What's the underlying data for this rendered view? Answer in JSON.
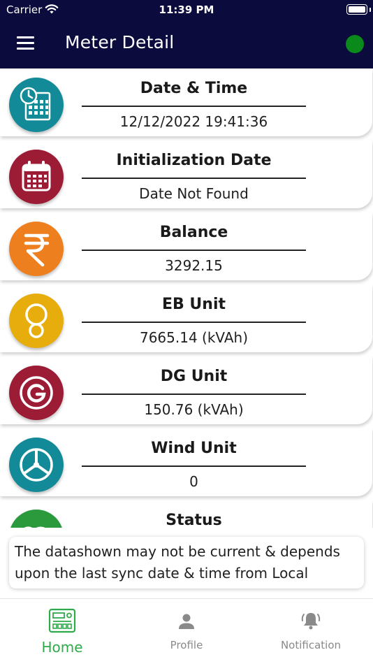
{
  "status_bar": {
    "carrier": "Carrier",
    "time": "11:39 PM"
  },
  "header": {
    "title": "Meter Detail",
    "connection_color": "#0a8a1a"
  },
  "items": [
    {
      "title": "Date & Time",
      "value": "12/12/2022 19:41:36",
      "icon": "calendar-clock-icon",
      "color": "#138a97"
    },
    {
      "title": "Initialization Date",
      "value": "Date Not Found",
      "icon": "calendar-icon",
      "color": "#9c1c35"
    },
    {
      "title": "Balance",
      "value": "3292.15",
      "icon": "rupee-icon",
      "color": "#ee7f1f"
    },
    {
      "title": "EB Unit",
      "value": "7665.14 (kVAh)",
      "icon": "bulb-icon",
      "color": "#e7ad0c"
    },
    {
      "title": "DG Unit",
      "value": "150.76 (kVAh)",
      "icon": "generator-icon",
      "color": "#9c1c35"
    },
    {
      "title": "Wind Unit",
      "value": "0",
      "icon": "wind-turbine-icon",
      "color": "#138a97"
    },
    {
      "title": "Status",
      "value": "",
      "icon": "status-icon",
      "color": "#2b9a3d"
    }
  ],
  "notice": {
    "text": "The datashown may not be current & depends upon the last sync date & time from Local"
  },
  "nav": {
    "home": {
      "label": "Home",
      "icon": "meter-icon",
      "color": "#2faa4a"
    },
    "profile": {
      "label": "Profile",
      "icon": "person-icon",
      "color": "#8a8a8a"
    },
    "notification": {
      "label": "Notification",
      "icon": "bell-icon",
      "color": "#8a8a8a"
    }
  }
}
